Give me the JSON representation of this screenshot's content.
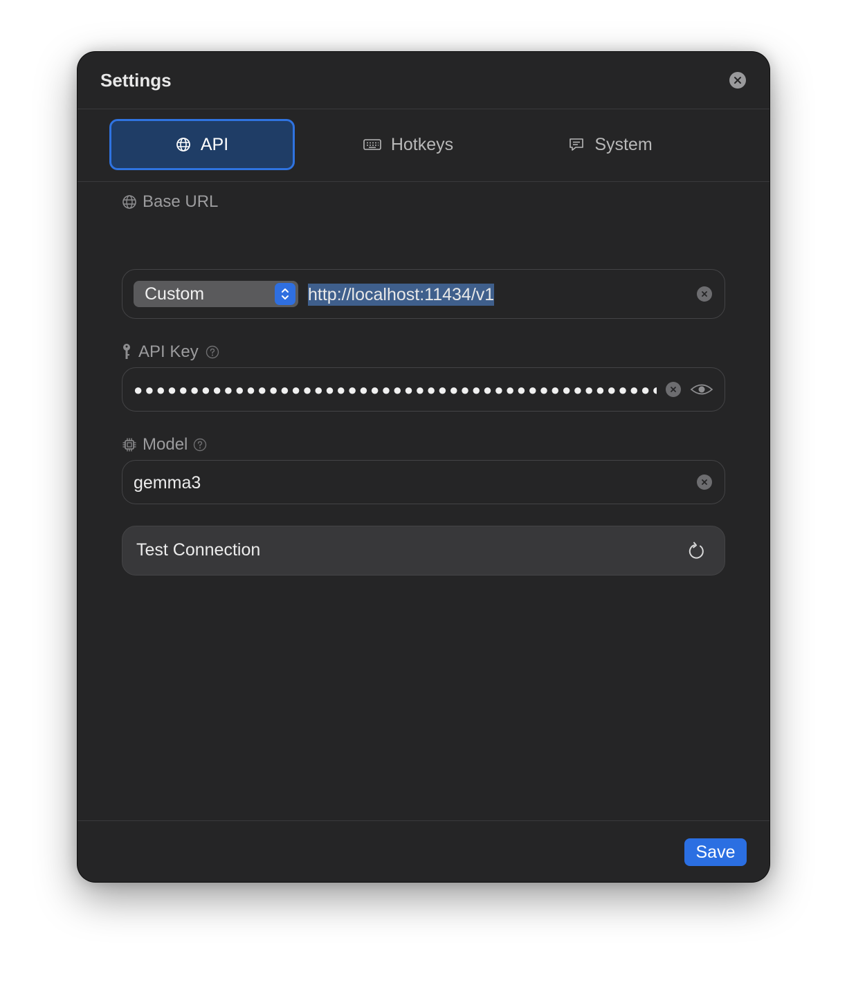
{
  "window": {
    "title": "Settings"
  },
  "tabs": [
    {
      "label": "API",
      "icon": "globe-icon",
      "active": true
    },
    {
      "label": "Hotkeys",
      "icon": "keyboard-icon",
      "active": false
    },
    {
      "label": "System",
      "icon": "chat-bubble-icon",
      "active": false
    }
  ],
  "base_url": {
    "label": "Base URL",
    "provider_selected": "Custom",
    "value": "http://localhost:11434/v1"
  },
  "api_key": {
    "label": "API Key",
    "masked_value": "●●●●●●●●●●●●●●●●●●●●●●●●●●●●●●●●●●●●●●●●●●●●●●●●●"
  },
  "model": {
    "label": "Model",
    "value": "gemma3"
  },
  "test_connection": {
    "label": "Test Connection"
  },
  "footer": {
    "save_label": "Save"
  },
  "colors": {
    "accent": "#2b6fe2",
    "background": "#252526",
    "active_tab_bg": "#1f3d66"
  }
}
